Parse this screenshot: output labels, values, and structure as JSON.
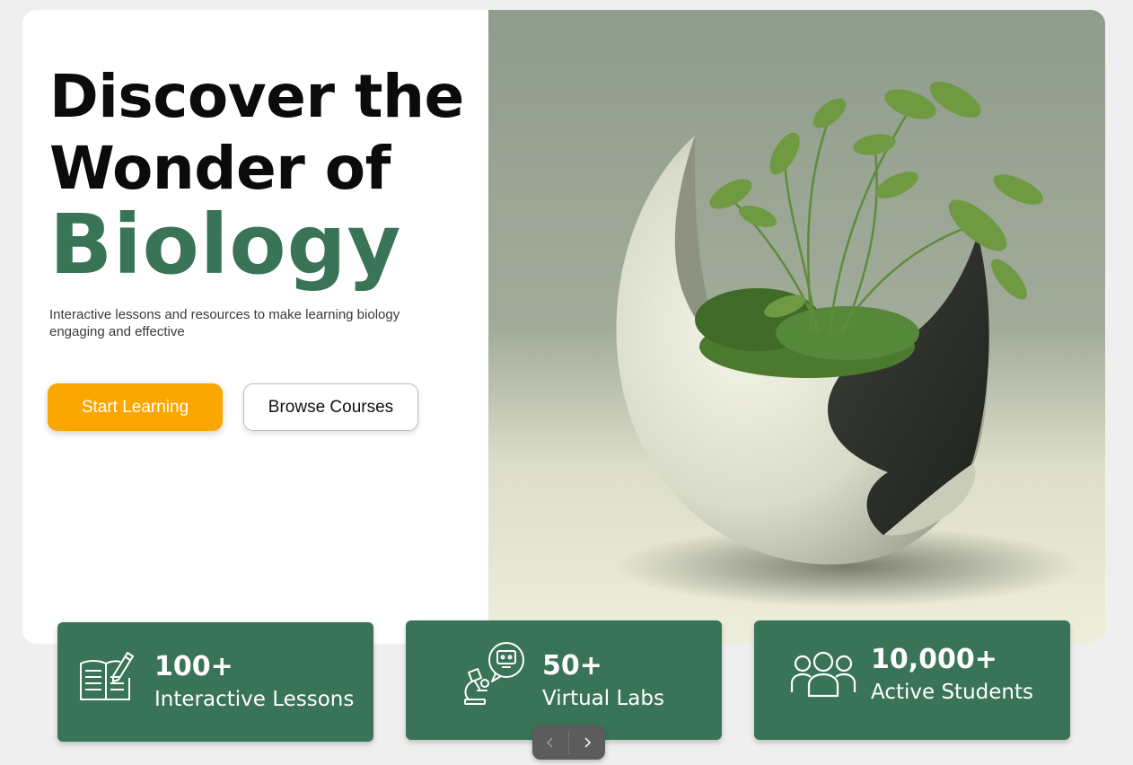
{
  "hero": {
    "title_line1": "Discover the",
    "title_line2": "Wonder of",
    "title_highlight": "Biology",
    "subtitle": "Interactive lessons and resources to make learning biology engaging and effective",
    "primary_button": "Start Learning",
    "secondary_button": "Browse Courses",
    "image_description_icon": "plant-in-pot-image"
  },
  "stats": [
    {
      "value": "100+",
      "label": "Interactive Lessons",
      "icon": "open-book-pencil-icon"
    },
    {
      "value": "50+",
      "label": "Virtual Labs",
      "icon": "microscope-monitor-icon"
    },
    {
      "value": "10,000+",
      "label": "Active Students",
      "icon": "group-users-icon"
    }
  ],
  "carousel": {
    "prev_icon": "chevron-left-icon",
    "next_icon": "chevron-right-icon"
  },
  "colors": {
    "accent_green": "#3a7458",
    "primary_orange": "#fca600",
    "background": "#efefef"
  }
}
